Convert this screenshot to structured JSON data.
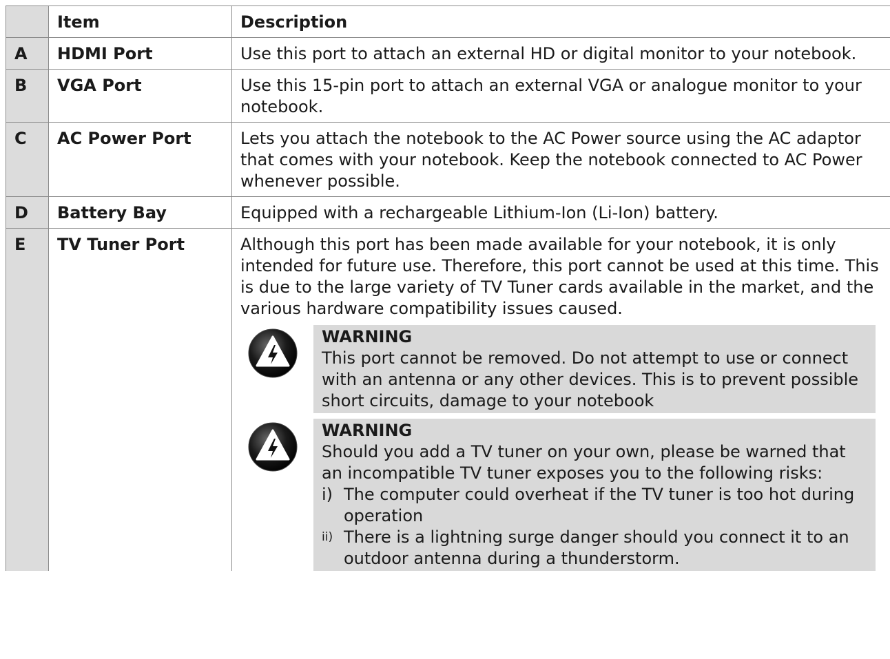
{
  "table": {
    "headers": {
      "letter": "",
      "item": "Item",
      "description": "Description"
    },
    "rows": [
      {
        "letter": "A",
        "item": "HDMI Port",
        "description": "Use this port to attach an external HD or digital monitor to your notebook."
      },
      {
        "letter": "B",
        "item": "VGA Port",
        "description": "Use this 15-pin port to attach an external VGA or analogue monitor to your notebook."
      },
      {
        "letter": "C",
        "item": "AC Power Port",
        "description": "Lets you attach the notebook to the AC Power source using the AC adaptor that comes with your notebook. Keep the notebook connected to AC Power whenever possible."
      },
      {
        "letter": "D",
        "item": "Battery Bay",
        "description": "Equipped with a rechargeable Lithium-Ion (Li-Ion) battery."
      },
      {
        "letter": "E",
        "item": "TV Tuner Port",
        "description": "Although this port has been made available for your notebook, it is only intended for future use. Therefore, this port cannot be used at this time. This is due to the large variety of TV Tuner cards available in the market, and the various hardware compatibility issues caused."
      }
    ]
  },
  "warnings": [
    {
      "icon": "warning-lightning-icon",
      "title": "WARNING",
      "text": "This port cannot be removed. Do not attempt to use or connect with an antenna or any other devices. This is to prevent possible short circuits, damage to your notebook"
    },
    {
      "icon": "warning-lightning-icon",
      "title": "WARNING",
      "text": "Should you add a TV tuner on your own, please be warned that an incompatible TV tuner exposes you to the following risks:",
      "risks": [
        {
          "num": "i)",
          "text": "The computer could overheat if the TV tuner is too hot during operation"
        },
        {
          "num": "ii)",
          "text": "There is a lightning surge danger should you connect it to an outdoor antenna during a thunderstorm."
        }
      ]
    }
  ],
  "colors": {
    "letter_column": "#dcdcdc",
    "warning_box": "#d9d9d9",
    "border": "#8a8a8a"
  }
}
